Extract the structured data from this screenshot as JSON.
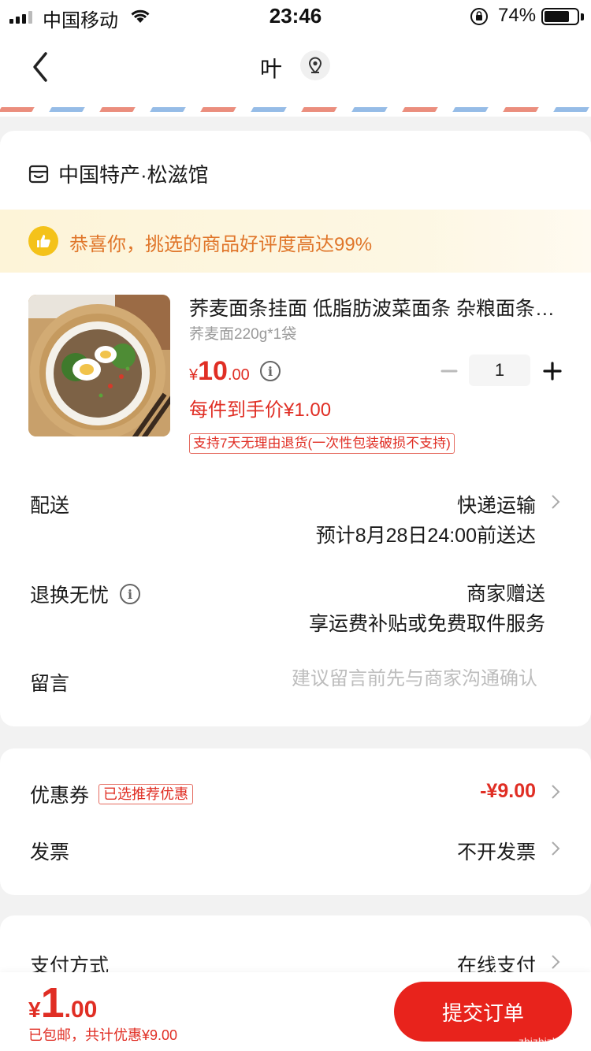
{
  "status_bar": {
    "carrier": "中国移动",
    "time": "23:46",
    "battery": "74%"
  },
  "nav": {
    "title": "叶",
    "back_icon": "chevron-left-icon",
    "location_icon": "location-pin-icon"
  },
  "order": {
    "shop_name": "中国特产·松滋馆",
    "praise_text": "恭喜你，挑选的商品好评度高达99%",
    "product": {
      "title": "荞麦面条挂面 低脂肪波菜面条 杂粮面条 荞麦面",
      "spec": "荞麦面220g*1袋",
      "price_currency": "¥",
      "price_int": "10",
      "price_dec": ".00",
      "final_price": "每件到手价¥1.00",
      "quantity": "1",
      "return_tag": "支持7天无理由退货(一次性包装破损不支持)"
    },
    "delivery": {
      "label": "配送",
      "value": "快递运输",
      "eta": "预计8月28日24:00前送达"
    },
    "return": {
      "label": "退换无忧",
      "value1": "商家赠送",
      "value2": "享运费补贴或免费取件服务"
    },
    "message": {
      "label": "留言",
      "placeholder": "建议留言前先与商家沟通确认"
    }
  },
  "coupon": {
    "label": "优惠券",
    "tag": "已选推荐优惠",
    "value": "-¥9.00"
  },
  "invoice": {
    "label": "发票",
    "value": "不开发票"
  },
  "payment": {
    "label": "支付方式",
    "value": "在线支付"
  },
  "bottom": {
    "total_currency": "¥",
    "total_int": "1",
    "total_dec": ".00",
    "sub": "已包邮，共计优惠¥9.00",
    "submit": "提交订单",
    "watermark": "zhizhizhi.com"
  },
  "colors": {
    "accent": "#e02e24",
    "button": "#e8231c",
    "praise_bg": "#fdf4d8",
    "praise_text": "#e0762a"
  }
}
